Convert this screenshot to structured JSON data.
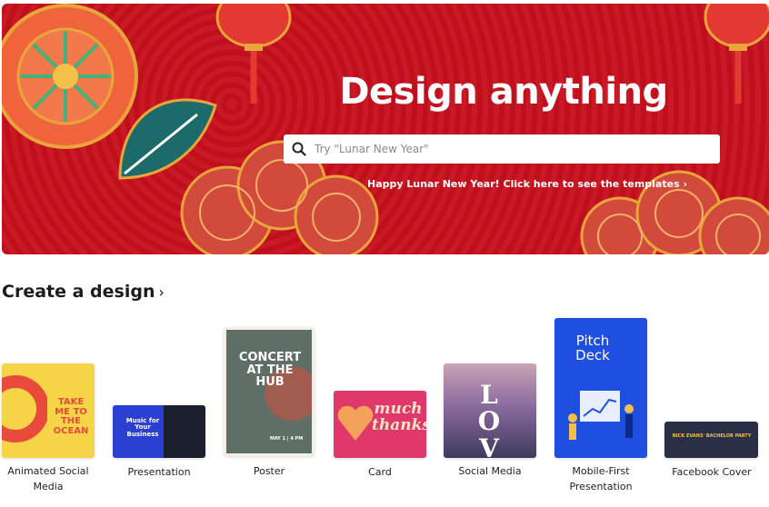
{
  "hero": {
    "title": "Design anything",
    "search_placeholder": "Try \"Lunar New Year\"",
    "promo_text": "Happy Lunar New Year! Click here to see the templates",
    "promo_chevron": "›",
    "colors": {
      "background": "#c8101d",
      "accent": "#e8a63a"
    }
  },
  "section": {
    "title": "Create a design",
    "chevron": "›"
  },
  "designs": [
    {
      "label_line1": "Animated Social",
      "label_line2": "Media",
      "thumb_text": "TAKE ME TO THE OCEAN",
      "color": "#f5d547"
    },
    {
      "label_line1": "Presentation",
      "label_line2": "",
      "thumb_text": "Music for Your Business",
      "color": "#2b3fd1"
    },
    {
      "label_line1": "Poster",
      "label_line2": "",
      "thumb_text": "CONCERT AT THE HUB",
      "thumb_sub": "MAY 1 | 4 PM",
      "color": "#5f6e66"
    },
    {
      "label_line1": "Card",
      "label_line2": "",
      "thumb_text": "much thanks",
      "color": "#e0386a"
    },
    {
      "label_line1": "Social Media",
      "label_line2": "",
      "thumb_text": "LOVE",
      "color": "#8a6b9e"
    },
    {
      "label_line1": "Mobile-First",
      "label_line2": "Presentation",
      "thumb_text": "Pitch Deck",
      "color": "#1f4fe0"
    },
    {
      "label_line1": "Facebook Cover",
      "label_line2": "",
      "thumb_text": "NICK EVANS' BACHELOR PARTY",
      "color": "#2a2f45"
    }
  ]
}
